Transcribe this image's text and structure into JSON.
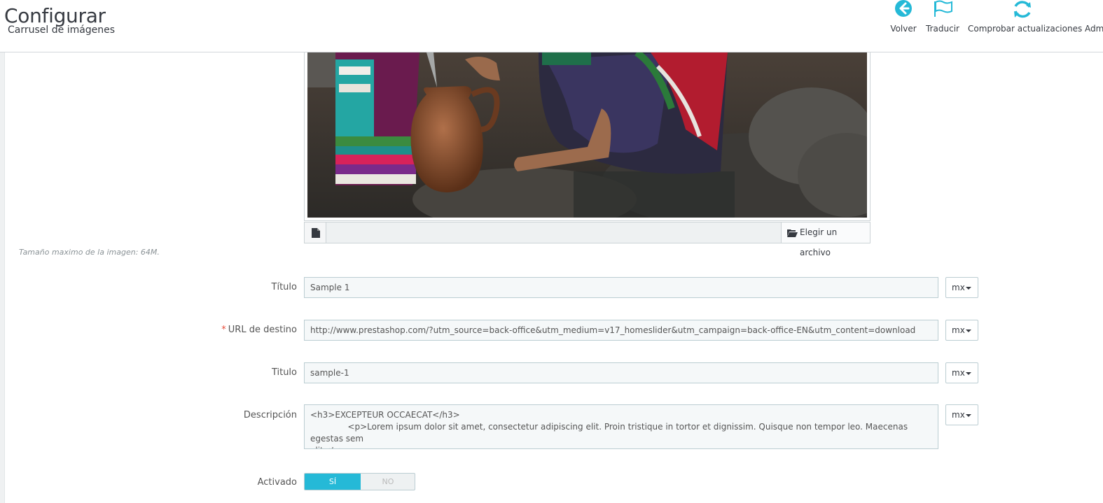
{
  "header": {
    "title": "Configurar",
    "subtitle": "Carrusel de imágenes",
    "toolbar": [
      {
        "label": "Volver",
        "icon": "back-arrow-icon"
      },
      {
        "label": "Traducir",
        "icon": "flag-icon"
      },
      {
        "label": "Comprobar actualizaciones",
        "icon": "refresh-icon"
      },
      {
        "label": "Adm",
        "icon": "help-icon"
      }
    ]
  },
  "image_upload": {
    "choose_label": "Elegir un archivo",
    "hint": "Tamaño maximo de la imagen: 64M."
  },
  "form": {
    "title1": {
      "label": "Título",
      "value": "Sample 1",
      "lang": "mx"
    },
    "url": {
      "label": "URL de destino",
      "required_mark": "*",
      "value": "http://www.prestashop.com/?utm_source=back-office&utm_medium=v17_homeslider&utm_campaign=back-office-EN&utm_content=download",
      "lang": "mx"
    },
    "title2": {
      "label": "Titulo",
      "value": "sample-1",
      "lang": "mx"
    },
    "description": {
      "label": "Descripción",
      "value": "<h3>EXCEPTEUR OCCAECAT</h3>\n              <p>Lorem ipsum dolor sit amet, consectetur adipiscing elit. Proin tristique in tortor et dignissim. Quisque non tempor leo. Maecenas egestas sem\nelit</p>",
      "lang": "mx"
    },
    "enabled": {
      "label": "Activado",
      "yes": "SÍ",
      "no": "NO",
      "value": "SÍ"
    }
  },
  "colors": {
    "accent": "#25b9d7",
    "required": "#e84e3b"
  }
}
